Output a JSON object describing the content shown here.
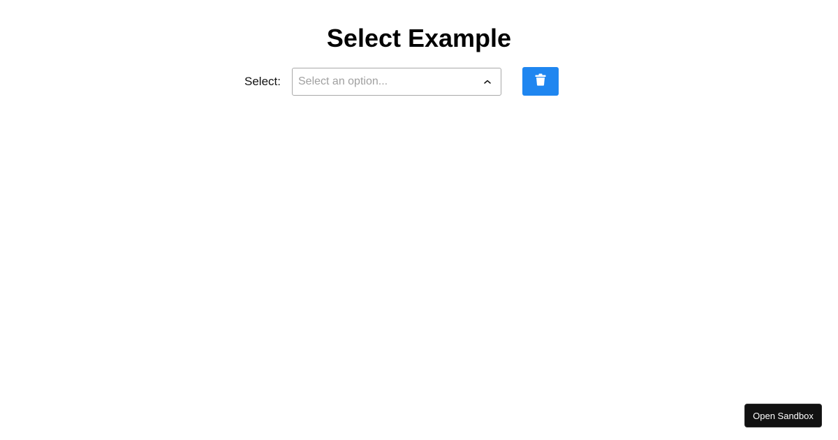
{
  "page": {
    "title": "Select Example"
  },
  "form": {
    "select_label": "Select:",
    "select_placeholder": "Select an option...",
    "select_icon": "chevron-up-icon",
    "delete_icon": "trash-icon"
  },
  "footer": {
    "sandbox_label": "Open Sandbox"
  },
  "colors": {
    "accent": "#1f86f0",
    "sandbox_bg": "#111111",
    "placeholder": "#a0a0a0",
    "border": "#a8a8a8"
  }
}
